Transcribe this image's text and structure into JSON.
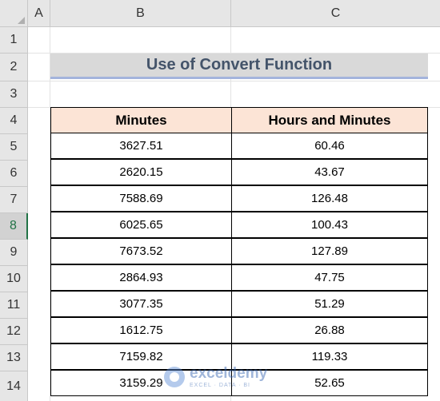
{
  "columns": [
    "A",
    "B",
    "C"
  ],
  "rows": [
    "1",
    "2",
    "3",
    "4",
    "5",
    "6",
    "7",
    "8",
    "9",
    "10",
    "11",
    "12",
    "13",
    "14"
  ],
  "active_row": "8",
  "title": "Use of Convert Function",
  "table": {
    "headers": [
      "Minutes",
      "Hours and Minutes"
    ],
    "rows": [
      [
        "3627.51",
        "60.46"
      ],
      [
        "2620.15",
        "43.67"
      ],
      [
        "7588.69",
        "126.48"
      ],
      [
        "6025.65",
        "100.43"
      ],
      [
        "7673.52",
        "127.89"
      ],
      [
        "2864.93",
        "47.75"
      ],
      [
        "3077.35",
        "51.29"
      ],
      [
        "1612.75",
        "26.88"
      ],
      [
        "7159.82",
        "119.33"
      ],
      [
        "3159.29",
        "52.65"
      ]
    ]
  },
  "watermark": {
    "name": "exceldemy",
    "tag": "EXCEL · DATA · BI"
  },
  "colors": {
    "header_fill": "#fce4d6",
    "title_fill": "#d9d9d9",
    "title_text": "#44546a",
    "accent": "#217346"
  }
}
